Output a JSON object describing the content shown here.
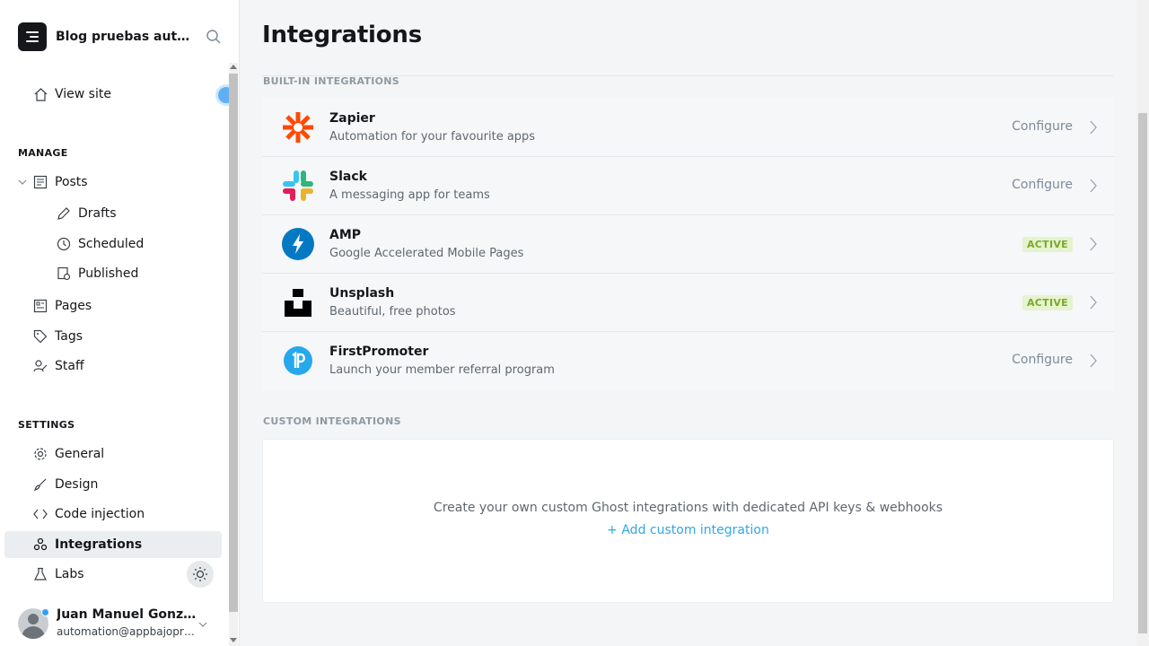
{
  "sidebar": {
    "brand_title": "Blog pruebas auto...",
    "view_site": "View site",
    "manage_heading": "MANAGE",
    "settings_heading": "SETTINGS",
    "posts": "Posts",
    "drafts": "Drafts",
    "scheduled": "Scheduled",
    "published": "Published",
    "pages": "Pages",
    "tags": "Tags",
    "staff": "Staff",
    "general": "General",
    "design": "Design",
    "code_injection": "Code injection",
    "integrations": "Integrations",
    "labs": "Labs",
    "user": {
      "name": "Juan Manuel Gonzále...",
      "email": "automation@appbajopru..."
    }
  },
  "main": {
    "title": "Integrations",
    "builtin_heading": "BUILT-IN INTEGRATIONS",
    "custom_heading": "CUSTOM INTEGRATIONS",
    "integrations": [
      {
        "name": "Zapier",
        "desc": "Automation for your favourite apps",
        "status": "Configure",
        "icon": "zapier-icon"
      },
      {
        "name": "Slack",
        "desc": "A messaging app for teams",
        "status": "Configure",
        "icon": "slack-icon"
      },
      {
        "name": "AMP",
        "desc": "Google Accelerated Mobile Pages",
        "status": "ACTIVE",
        "icon": "amp-icon"
      },
      {
        "name": "Unsplash",
        "desc": "Beautiful, free photos",
        "status": "ACTIVE",
        "icon": "unsplash-icon"
      },
      {
        "name": "FirstPromoter",
        "desc": "Launch your member referral program",
        "status": "Configure",
        "icon": "firstpromoter-icon"
      }
    ],
    "custom_message": "Create your own custom Ghost integrations with dedicated API keys & webhooks",
    "add_custom": "+ Add custom integration"
  },
  "colors": {
    "accent": "#30a7e6",
    "active_badge": "#7aa92c",
    "zapier": "#ff4a00",
    "amp": "#0379c4",
    "firstpromoter": "#26a8ec"
  }
}
